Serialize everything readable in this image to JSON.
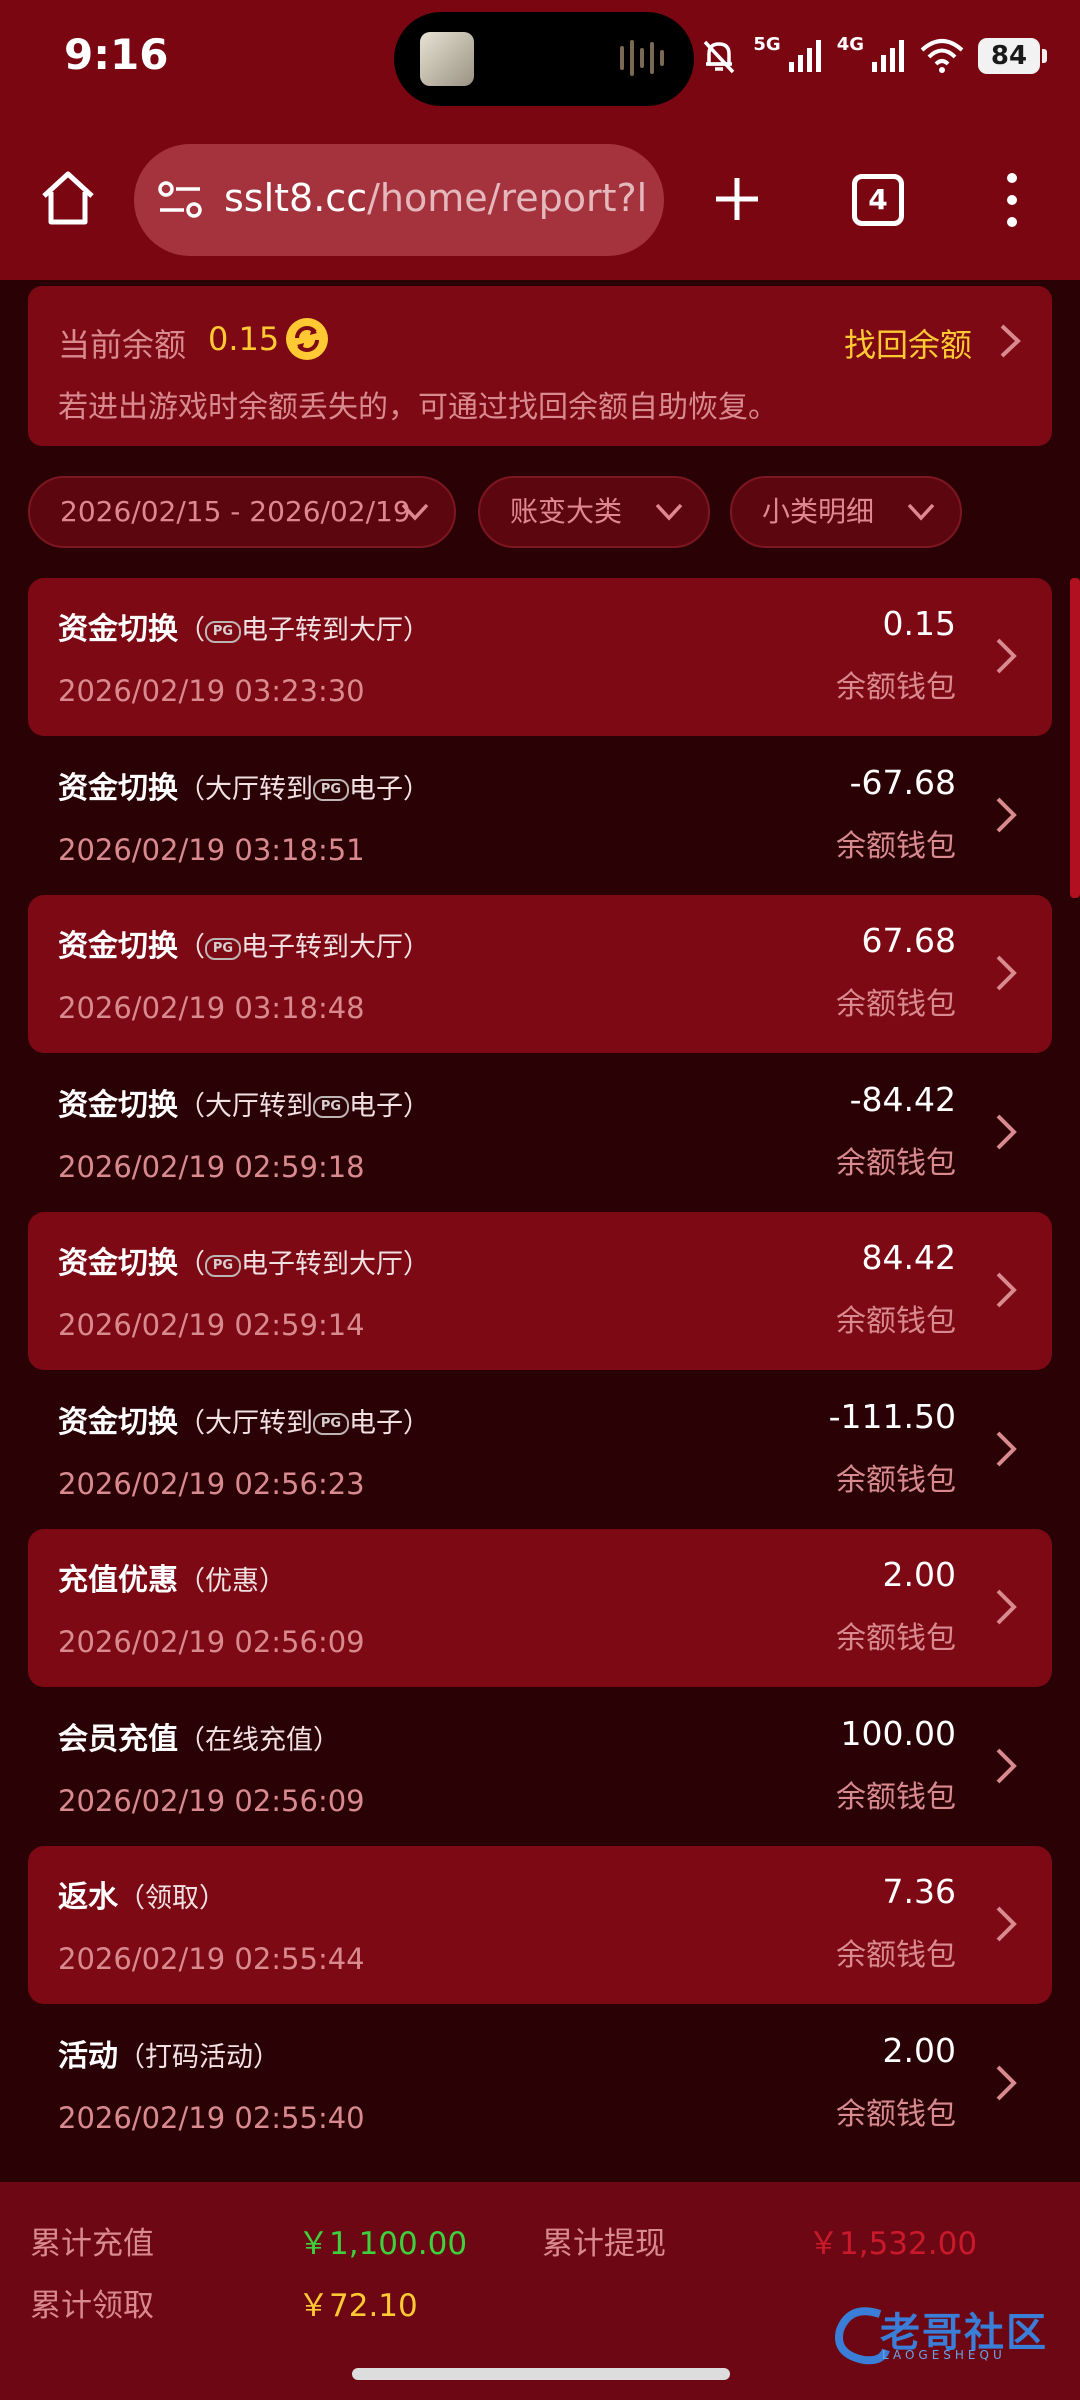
{
  "status_bar": {
    "time": "9:16",
    "net1": "5G",
    "net2": "4G",
    "battery": "84"
  },
  "browser": {
    "url_domain": "sslt8.cc",
    "url_path": "/home/report?l",
    "tab_count": "4"
  },
  "balance": {
    "label": "当前余额",
    "value": "0.15",
    "recover_label": "找回余额",
    "tip": "若进出游戏时余额丢失的，可通过找回余额自助恢复。"
  },
  "filters": {
    "date_range": "2026/02/15 - 2026/02/19",
    "category": "账变大类",
    "subcategory": "小类明细"
  },
  "records": [
    {
      "title": "资金切换",
      "sub_pre": "（",
      "sub_pg_first": true,
      "sub_text": "电子转到大厅）",
      "date": "2026/02/19 03:23:30",
      "amount": "0.15",
      "wallet": "余额钱包"
    },
    {
      "title": "资金切换",
      "sub_pre": "（大厅转到",
      "sub_pg_first": false,
      "sub_text": "电子）",
      "date": "2026/02/19 03:18:51",
      "amount": "-67.68",
      "wallet": "余额钱包"
    },
    {
      "title": "资金切换",
      "sub_pre": "（",
      "sub_pg_first": true,
      "sub_text": "电子转到大厅）",
      "date": "2026/02/19 03:18:48",
      "amount": "67.68",
      "wallet": "余额钱包"
    },
    {
      "title": "资金切换",
      "sub_pre": "（大厅转到",
      "sub_pg_first": false,
      "sub_text": "电子）",
      "date": "2026/02/19 02:59:18",
      "amount": "-84.42",
      "wallet": "余额钱包"
    },
    {
      "title": "资金切换",
      "sub_pre": "（",
      "sub_pg_first": true,
      "sub_text": "电子转到大厅）",
      "date": "2026/02/19 02:59:14",
      "amount": "84.42",
      "wallet": "余额钱包"
    },
    {
      "title": "资金切换",
      "sub_pre": "（大厅转到",
      "sub_pg_first": false,
      "sub_text": "电子）",
      "date": "2026/02/19 02:56:23",
      "amount": "-111.50",
      "wallet": "余额钱包"
    },
    {
      "title": "充值优惠",
      "sub_pre": "（优惠）",
      "sub_pg_first": null,
      "sub_text": "",
      "date": "2026/02/19 02:56:09",
      "amount": "2.00",
      "wallet": "余额钱包"
    },
    {
      "title": "会员充值",
      "sub_pre": "（在线充值）",
      "sub_pg_first": null,
      "sub_text": "",
      "date": "2026/02/19 02:56:09",
      "amount": "100.00",
      "wallet": "余额钱包"
    },
    {
      "title": "返水",
      "sub_pre": "（领取）",
      "sub_pg_first": null,
      "sub_text": "",
      "date": "2026/02/19 02:55:44",
      "amount": "7.36",
      "wallet": "余额钱包"
    },
    {
      "title": "活动",
      "sub_pre": "（打码活动）",
      "sub_pg_first": null,
      "sub_text": "",
      "date": "2026/02/19 02:55:40",
      "amount": "2.00",
      "wallet": "余额钱包"
    }
  ],
  "pg_badge": "PG",
  "summary": {
    "total_deposit_label": "累计充值",
    "total_deposit": "￥1,100.00",
    "total_withdraw_label": "累计提现",
    "total_withdraw": "￥1,532.00",
    "total_claim_label": "累计领取",
    "total_claim": "￥72.10"
  },
  "watermark": {
    "text": "老哥社区",
    "sub": "LAOGESHEQU"
  },
  "colors": {
    "header_bg": "#7a0612",
    "card_bg": "#7c0914",
    "page_bg": "#2a0206",
    "gold": "#ffc933",
    "green": "#3ed13e",
    "red_value": "#c81a2a",
    "muted_pink": "#d98a8f"
  }
}
